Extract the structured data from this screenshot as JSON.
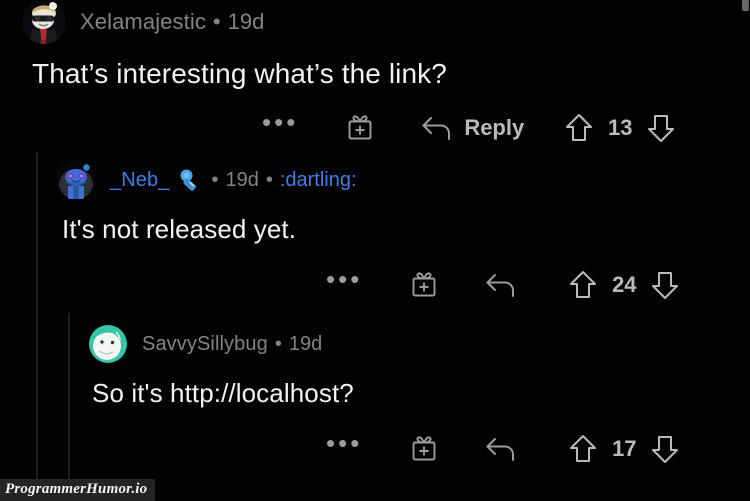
{
  "app": {
    "background_color": "#030303",
    "text_color": "#f2f2f2",
    "muted_color": "#818384",
    "accent_color": "#3f7ee8",
    "watermark": "ProgrammerHumor.io"
  },
  "comments": [
    {
      "id": "comment-1",
      "author": "Xelamajestic",
      "separator": "•",
      "age": "19d",
      "flair": "",
      "body": "That’s interesting what’s the link?",
      "avatar_name": "avatar-xelamajestic",
      "actions": {
        "more_label": "•••",
        "more_name": "more-options-icon",
        "gift_name": "gift-award-icon",
        "reply_name": "reply-icon",
        "reply_label": "Reply",
        "upvote_name": "upvote-arrow-icon",
        "downvote_name": "downvote-arrow-icon",
        "score": "13"
      }
    },
    {
      "id": "comment-2",
      "author": "_Neb_",
      "separator": "•",
      "age": "19d",
      "flair": ":dartling:",
      "emoji_name": "dart-emoji",
      "body": "It's not released yet.",
      "avatar_name": "avatar-neb",
      "actions": {
        "more_label": "•••",
        "more_name": "more-options-icon",
        "gift_name": "gift-award-icon",
        "reply_name": "reply-icon",
        "reply_label": "",
        "upvote_name": "upvote-arrow-icon",
        "downvote_name": "downvote-arrow-icon",
        "score": "24"
      }
    },
    {
      "id": "comment-3",
      "author": "SavvySillybug",
      "separator": "•",
      "age": "19d",
      "flair": "",
      "body": "So it's http://localhost?",
      "avatar_name": "avatar-savvysillybug",
      "actions": {
        "more_label": "•••",
        "more_name": "more-options-icon",
        "gift_name": "gift-award-icon",
        "reply_name": "reply-icon",
        "reply_label": "",
        "upvote_name": "upvote-arrow-icon",
        "downvote_name": "downvote-arrow-icon",
        "score": "17"
      }
    }
  ]
}
